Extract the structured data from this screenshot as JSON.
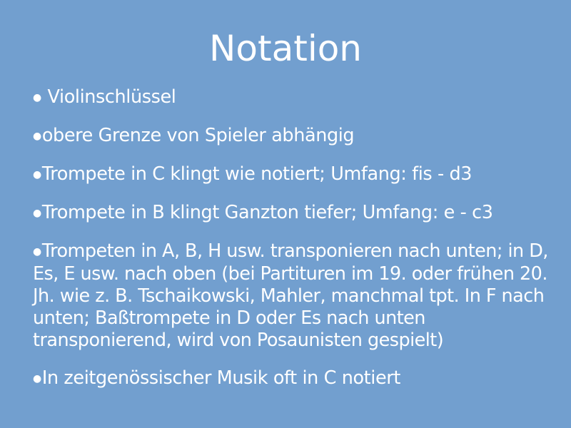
{
  "slide": {
    "title": "Notation",
    "bullet_symbol": "●",
    "bullets": [
      " Violinschlüssel",
      "obere Grenze von Spieler abhängig",
      "Trompete in C klingt wie notiert; Umfang: fis - d3",
      "Trompete in B klingt Ganzton tiefer; Umfang: e - c3",
      "Trompeten in A, B, H usw.  transponieren nach unten; in D, Es, E usw. nach oben (bei Partituren im 19. oder frühen 20. Jh. wie z. B. Tschaikowski, Mahler, manchmal tpt. In F nach unten; Baßtrompete in D oder Es nach unten transponierend, wird von Posaunisten gespielt)",
      "In zeitgenössischer Musik oft in C notiert"
    ],
    "colors": {
      "background": "#729fcf",
      "text": "#ffffff"
    }
  }
}
